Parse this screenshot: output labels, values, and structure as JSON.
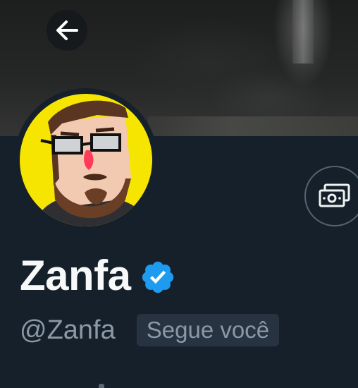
{
  "profile": {
    "display_name": "Zanfa",
    "handle": "@Zanfa",
    "follows_you_badge": "Segue você",
    "verified": true
  },
  "icons": {
    "back": "back-arrow-icon",
    "verified": "verified-badge-icon",
    "tip": "tip-money-icon"
  },
  "colors": {
    "background": "#15202b",
    "primary_text": "#f7f9f9",
    "secondary_text": "#8b98a5",
    "verified_blue": "#1d9bf0",
    "avatar_bg": "#f5e500",
    "badge_bg": "#273340"
  }
}
